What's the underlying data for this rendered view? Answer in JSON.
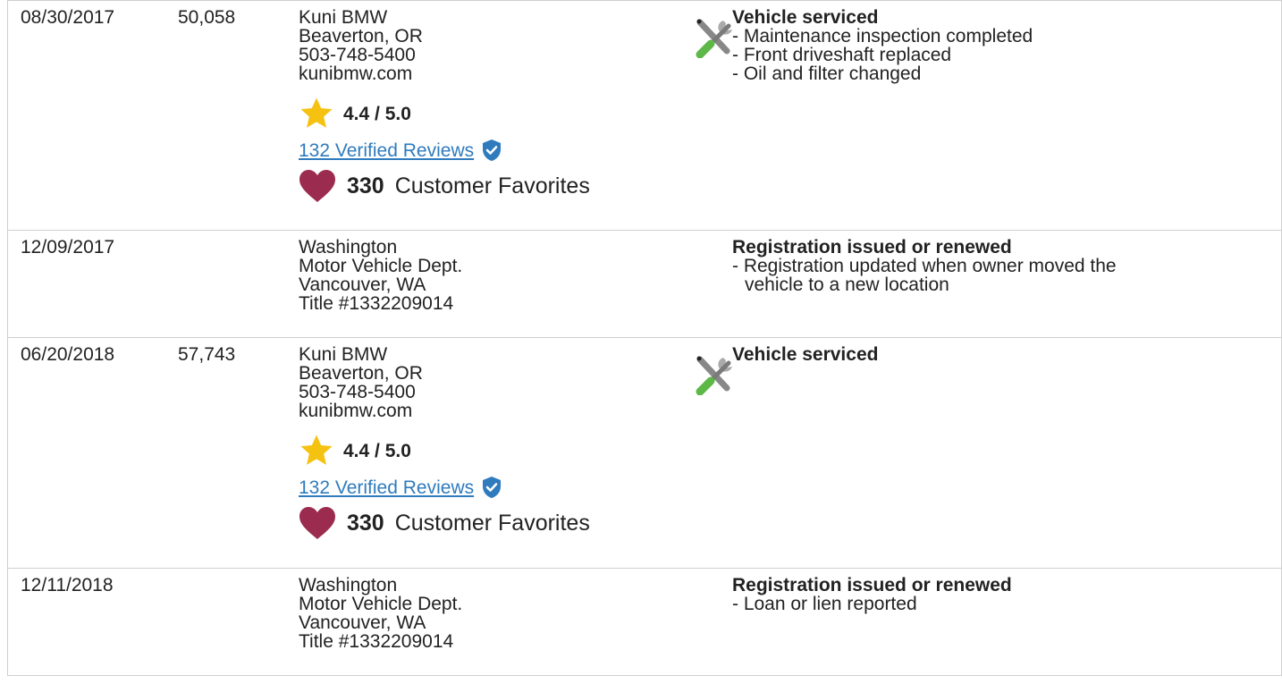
{
  "records": [
    {
      "date": "08/30/2017",
      "mileage": "50,058",
      "source": [
        "Kuni BMW",
        "Beaverton, OR",
        "503-748-5400",
        "kunibmw.com"
      ],
      "rating": "4.4 / 5.0",
      "reviews": "132 Verified Reviews",
      "favorites_count": "330",
      "favorites_label": "Customer Favorites",
      "icon": "service-tools-icon",
      "title": "Vehicle serviced",
      "lines": [
        "- Maintenance inspection completed",
        "- Front driveshaft replaced",
        "- Oil and filter changed"
      ]
    },
    {
      "date": "12/09/2017",
      "mileage": "",
      "source": [
        "Washington",
        "Motor Vehicle Dept.",
        "Vancouver, WA",
        "Title #1332209014"
      ],
      "title": "Registration issued or renewed",
      "lines": [
        "- Registration updated when owner moved the",
        "vehicle to a new location"
      ]
    },
    {
      "date": "06/20/2018",
      "mileage": "57,743",
      "source": [
        "Kuni BMW",
        "Beaverton, OR",
        "503-748-5400",
        "kunibmw.com"
      ],
      "rating": "4.4 / 5.0",
      "reviews": "132 Verified Reviews",
      "favorites_count": "330",
      "favorites_label": "Customer Favorites",
      "icon": "service-tools-icon",
      "title": "Vehicle serviced",
      "lines": []
    },
    {
      "date": "12/11/2018",
      "mileage": "",
      "source": [
        "Washington",
        "Motor Vehicle Dept.",
        "Vancouver, WA",
        "Title #1332209014"
      ],
      "title": "Registration issued or renewed",
      "lines": [
        "- Loan or lien reported"
      ]
    }
  ],
  "colors": {
    "link": "#2f7bbd",
    "star": "#f5c211",
    "heart": "#9b2c4f",
    "shield": "#2f7bbd",
    "border": "#cfcfcf"
  }
}
